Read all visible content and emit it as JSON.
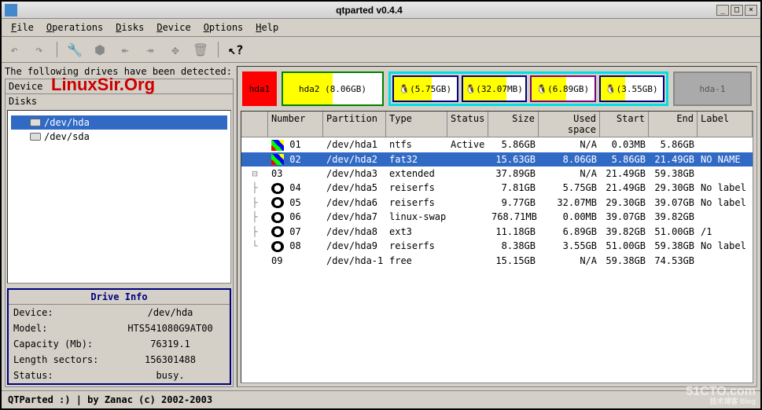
{
  "window": {
    "title": "qtparted v0.4.4"
  },
  "menubar": [
    {
      "label": "File",
      "key": "F"
    },
    {
      "label": "Operations",
      "key": "O"
    },
    {
      "label": "Disks",
      "key": "D"
    },
    {
      "label": "Device",
      "key": "D"
    },
    {
      "label": "Options",
      "key": "O"
    },
    {
      "label": "Help",
      "key": "H"
    }
  ],
  "left": {
    "detected_text": "The following drives have been detected:",
    "device_header": "Device",
    "disks_label": "Disks",
    "watermark": "LinuxSir.Org",
    "disks": [
      {
        "path": "/dev/hda",
        "selected": true
      },
      {
        "path": "/dev/sda",
        "selected": false
      }
    ],
    "drive_info": {
      "title": "Drive Info",
      "rows": [
        {
          "label": "Device:",
          "value": "/dev/hda"
        },
        {
          "label": "Model:",
          "value": "HTS541080G9AT00"
        },
        {
          "label": "Capacity (Mb):",
          "value": "76319.1"
        },
        {
          "label": "Length sectors:",
          "value": "156301488"
        },
        {
          "label": "Status:",
          "value": "busy."
        }
      ]
    }
  },
  "vis": {
    "hda1": "hda1",
    "hda2": "hda2 (8.06GB)",
    "subs": [
      {
        "text": "(5.75GB)",
        "border": "#000080",
        "fill": 60
      },
      {
        "text": "(32.07MB)",
        "border": "#000080",
        "fill": 70
      },
      {
        "text": "(6.89GB)",
        "border": "#800080",
        "fill": 55
      },
      {
        "text": "(3.55GB)",
        "border": "#000080",
        "fill": 40
      }
    ],
    "free": "hda-1"
  },
  "table": {
    "headers": [
      "Number",
      "Partition",
      "Type",
      "Status",
      "Size",
      "Used space",
      "Start",
      "End",
      "Label"
    ],
    "rows": [
      {
        "icon": "win",
        "num": "01",
        "part": "/dev/hda1",
        "type": "ntfs",
        "status": "Active",
        "size": "5.86GB",
        "used": "N/A",
        "start": "0.03MB",
        "end": "5.86GB",
        "label": "",
        "tree": ""
      },
      {
        "icon": "win",
        "num": "02",
        "part": "/dev/hda2",
        "type": "fat32",
        "status": "",
        "size": "15.63GB",
        "used": "8.06GB",
        "start": "5.86GB",
        "end": "21.49GB",
        "label": "NO NAME",
        "tree": "",
        "selected": true
      },
      {
        "icon": "",
        "num": "03",
        "part": "/dev/hda3",
        "type": "extended",
        "status": "",
        "size": "37.89GB",
        "used": "N/A",
        "start": "21.49GB",
        "end": "59.38GB",
        "label": "",
        "tree": "⊟"
      },
      {
        "icon": "linux",
        "num": "04",
        "part": "/dev/hda5",
        "type": "reiserfs",
        "status": "",
        "size": "7.81GB",
        "used": "5.75GB",
        "start": "21.49GB",
        "end": "29.30GB",
        "label": "No label",
        "tree": "├"
      },
      {
        "icon": "linux",
        "num": "05",
        "part": "/dev/hda6",
        "type": "reiserfs",
        "status": "",
        "size": "9.77GB",
        "used": "32.07MB",
        "start": "29.30GB",
        "end": "39.07GB",
        "label": "No label",
        "tree": "├"
      },
      {
        "icon": "linux",
        "num": "06",
        "part": "/dev/hda7",
        "type": "linux-swap",
        "status": "",
        "size": "768.71MB",
        "used": "0.00MB",
        "start": "39.07GB",
        "end": "39.82GB",
        "label": "",
        "tree": "├"
      },
      {
        "icon": "linux",
        "num": "07",
        "part": "/dev/hda8",
        "type": "ext3",
        "status": "",
        "size": "11.18GB",
        "used": "6.89GB",
        "start": "39.82GB",
        "end": "51.00GB",
        "label": "/1",
        "tree": "├"
      },
      {
        "icon": "linux",
        "num": "08",
        "part": "/dev/hda9",
        "type": "reiserfs",
        "status": "",
        "size": "8.38GB",
        "used": "3.55GB",
        "start": "51.00GB",
        "end": "59.38GB",
        "label": "No label",
        "tree": "└"
      },
      {
        "icon": "",
        "num": "09",
        "part": "/dev/hda-1",
        "type": "free",
        "status": "",
        "size": "15.15GB",
        "used": "N/A",
        "start": "59.38GB",
        "end": "74.53GB",
        "label": "",
        "tree": ""
      }
    ]
  },
  "statusbar": "QTParted :) | by Zanac (c) 2002-2003",
  "corner": {
    "main": "51CTO.com",
    "sub": "技术博客  Blog"
  }
}
